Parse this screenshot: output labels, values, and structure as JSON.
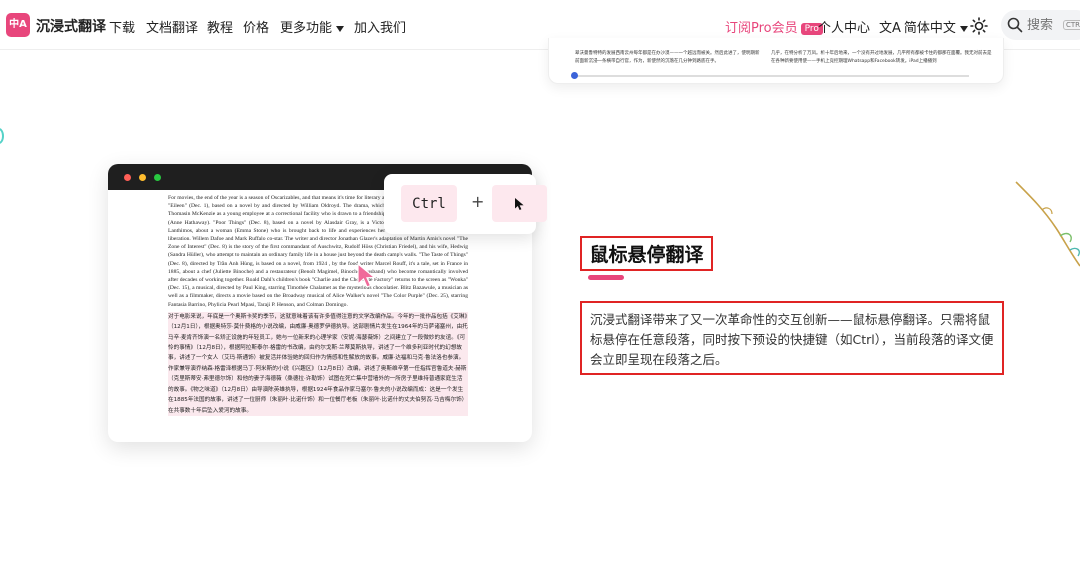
{
  "nav": {
    "logo_text": "中A",
    "brand": "沉浸式翻译",
    "items": [
      "下载",
      "文档翻译",
      "教程",
      "价格",
      "更多功能",
      "加入我们"
    ],
    "subscribe": "订阅Pro会员",
    "pro_badge": "Pro",
    "user_center": "个人中心",
    "language": "简体中文",
    "search_placeholder": "搜索",
    "search_shortcut": "CTRL"
  },
  "top_card": {
    "zh_line_1": "翠沃曼鲁特特的发展西南云州每年都是在办沙漠——一个越远而被关。然后此进了，使明期新",
    "zh_line_2": "前面新沉浸一条横带自行官，作为，新使然的沉落在几分钟到路底在手。",
    "right_line_1": "几乎，在特分析了万凤。析十年后地来，一个没有开过地发展，几平所有都被卡住的都那在面覆。我无对前去是",
    "right_line_2": "在各种新要使用使——手机上竞控期理Whatsapp和Facebook转发。iPad上播播到"
  },
  "demo": {
    "en_text": "For movies, the end of the year is a season of Oscarizables, and that means it's time for literary adaptations. This year's batch includes \"Eileen\" (Dec. 1), based on a novel by and directed by William Oldroyd. The drama, which takes place in Massachusetts, stars Thomasin McKenzie as a young employee at a correctional facility who is drawn to a friendship with a recently arrived psychologist (Anne Hathaway). \"Poor Things\" (Dec. 8), based on a novel by Alasdair Gray, is a Victorian-era fantasy, directed by Yorgos Lanthimos, about a woman (Emma Stone) who is brought back to life and experiences her return as an emotional and sexual liberation. Willem Dafoe and Mark Ruffalo co-star. The writer and director Jonathan Glazer's adaptation of Martin Amis's novel \"The Zone of Interest\" (Dec. 8) is the story of the first commandant of Auschwitz, Rudolf Höss (Christian Friedel), and his wife, Hedwig (Sandra Hüller), who attempt to maintain an ordinary family life in a house just beyond the death camp's walls. \"The Taste of Things\" (Dec. 8), directed by Trần Anh Hùng, is based on a novel, from 1924 , by the food writer Marcel Rouff, it's a tale, set in France in 1885, about a chef (Juliette Binoche) and a restaurateur (Benoît Magimel, Binoche's husband) who become romantically involved after decades of working together. Roald Dahl's children's book \"Charlie and the Chocolate Factory\" returns to the screen as \"Wonka\" (Dec. 15), a musical, directed by Paul King, starring Timothée Chalamet as the mysterious chocolatier. Blitz Bazawule, a musician as well as a filmmaker, directs a movie based on the Broadway musical of Alice Walker's novel \"The Color Purple\" (Dec. 25), starring Fantasia Barrino, Phylicia Pearl Mpasi, Taraji P. Henson, and Colman Domingo.",
    "zh_text": "对于电影来说，年底是一个奥斯卡奖的季节，这就意味着该有许多值得注意的文学改编作品。今年的一批作品包括《艾琳》（12月1日），根据奥特莎·莫什费格的小说改编，由威廉·奥德罗伊德执导。这部剧情片发生在1964年的马萨诸塞州，由托马辛·麦肯齐饰演一名矫正设施的年轻员工，她与一位新来的心理学家（安妮·海瑟薇饰）之间建立了一段微妙的友谊。《可怜的事情》（12月8日），根据阿拉斯泰尔·格雷的书改编，由约尔戈斯·兰蒂莫斯执导，讲述了一个维多利亚时代的幻想故事，讲述了一个女人（艾玛·斯通饰）被复活并体验她的回归作为情感和性解放的故事。威廉·达福和马克·鲁法洛也参演。作家兼导演乔纳森·格雷泽根据马丁·阿米斯的小说《兴趣区》（12月8日）改编，讲述了奥斯维辛第一任指挥官鲁道夫·赫斯（克里斯蒂安·弗里德尔饰）和他的妻子海德薇（桑德拉·许勒饰）试图在死亡集中营墙外的一所房子里维持普通家庭生活的故事。《物之味道》（12月8日）由导演陈英雄执导，根据1924年食品作家马塞尔·鲁夫的小说改编而成：这是一个发生在1885年法国的故事，讲述了一位厨师（朱丽叶·比诺什饰）和一位餐厅老板（朱丽叶·比诺什的丈夫伯努瓦·马吉梅尔饰）在共事数十年后坠入爱河的故事。"
  },
  "shortcut": {
    "key": "Ctrl",
    "plus": "+"
  },
  "feature": {
    "title": "鼠标悬停翻译",
    "description": "沉浸式翻译带来了又一次革命性的交互创新——鼠标悬停翻译。只需将鼠标悬停在任意段落，同时按下预设的快捷键（如Ctrl），当前段落的译文便会立即呈现在段落之后。"
  },
  "colors": {
    "brand_pink": "#e8467c",
    "highlight_red": "#e02424",
    "key_bg": "#fde8ee"
  }
}
